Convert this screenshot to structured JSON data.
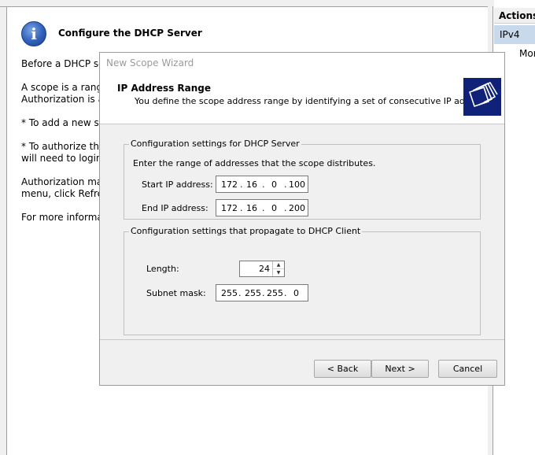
{
  "background": {
    "title": "Configure the DHCP Server",
    "paragraphs": [
      "Before a DHCP serv",
      "A scope is a range",
      "Authorization is a s",
      "* To add a new sco",
      "* To authorize this",
      "will need to login a",
      "Authorization may",
      "menu, click Refresh",
      "For more informati"
    ]
  },
  "actions": {
    "header": "Actions",
    "selected": "IPv4",
    "more": "Mor"
  },
  "wizard": {
    "title": "New Scope Wizard",
    "header_title": "IP Address Range",
    "header_subtitle": "You define the scope address range by identifying a set of consecutive IP addresses.",
    "server_group": {
      "legend": "Configuration settings for DHCP Server",
      "instruction": "Enter the range of addresses that the scope distributes.",
      "start_label": "Start IP address:",
      "start_ip": [
        "172",
        "16",
        "0",
        "100"
      ],
      "end_label": "End IP address:",
      "end_ip": [
        "172",
        "16",
        "0",
        "200"
      ]
    },
    "client_group": {
      "legend": "Configuration settings that propagate to DHCP Client",
      "length_label": "Length:",
      "length_value": "24",
      "mask_label": "Subnet mask:",
      "mask": [
        "255",
        "255",
        "255",
        "0"
      ]
    },
    "buttons": {
      "back": "< Back",
      "next": "Next >",
      "cancel": "Cancel"
    }
  },
  "colors": {
    "selection": "#c9d9ec",
    "logo": "#0f2178",
    "dialog_bg": "#f0f0f0"
  }
}
